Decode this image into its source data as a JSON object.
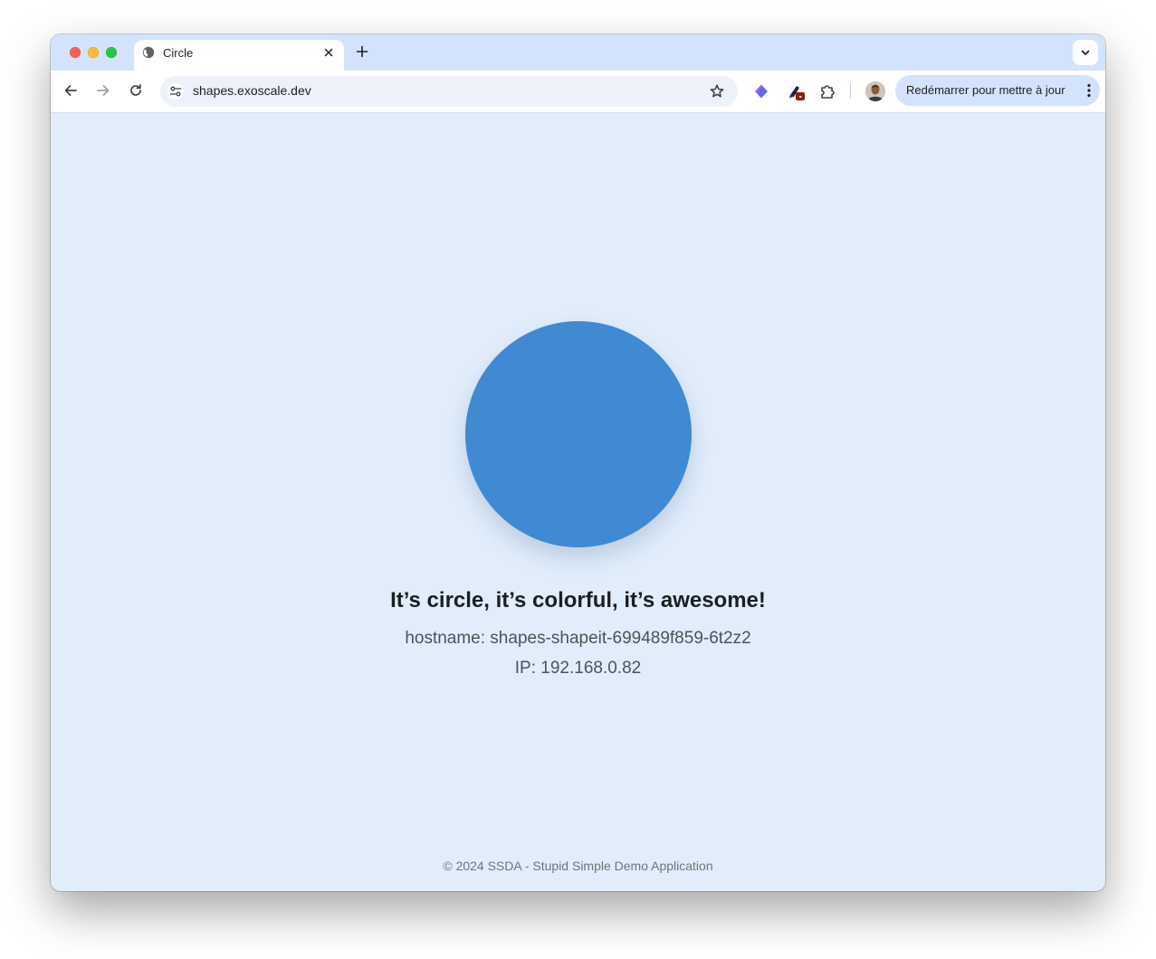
{
  "browser": {
    "tab": {
      "title": "Circle",
      "favicon": "globe-icon"
    },
    "address_bar": {
      "url": "shapes.exoscale.dev"
    },
    "update_button": {
      "label": "Redémarrer pour mettre à jour"
    }
  },
  "page": {
    "shape": {
      "type": "circle",
      "color": "#3f8ad2"
    },
    "headline": "It’s circle, it’s colorful, it’s awesome!",
    "hostname": "hostname: shapes-shapeit-699489f859-6t2z2",
    "ip": "IP: 192.168.0.82",
    "footer": "© 2024 SSDA - Stupid Simple Demo Application",
    "background_color": "#e1edfb"
  }
}
